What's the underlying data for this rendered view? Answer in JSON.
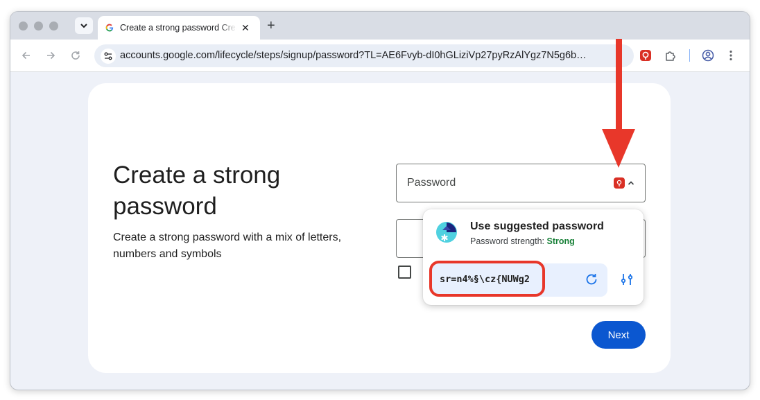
{
  "browser": {
    "tab": {
      "title": "Create a strong password Create a strong password",
      "close_glyph": "✕"
    },
    "new_tab_glyph": "+",
    "url": "accounts.google.com/lifecycle/steps/signup/password?TL=AE6Fvyb-dI0hGLiziVp27pyRzAlYgz7N5g6b…"
  },
  "page": {
    "heading": "Create a strong password",
    "description": "Create a strong password with a mix of letters, numbers and symbols",
    "password_label": "Password",
    "next_label": "Next"
  },
  "popup": {
    "title": "Use suggested password",
    "strength_label": "Password strength:",
    "strength_value": "Strong",
    "suggested_password": "sr=n4%§\\cz{NUWg2"
  },
  "colors": {
    "accent_blue": "#0b57d0",
    "annotation_red": "#e8372a",
    "strength_green": "#188038",
    "extension_red": "#d93025"
  }
}
